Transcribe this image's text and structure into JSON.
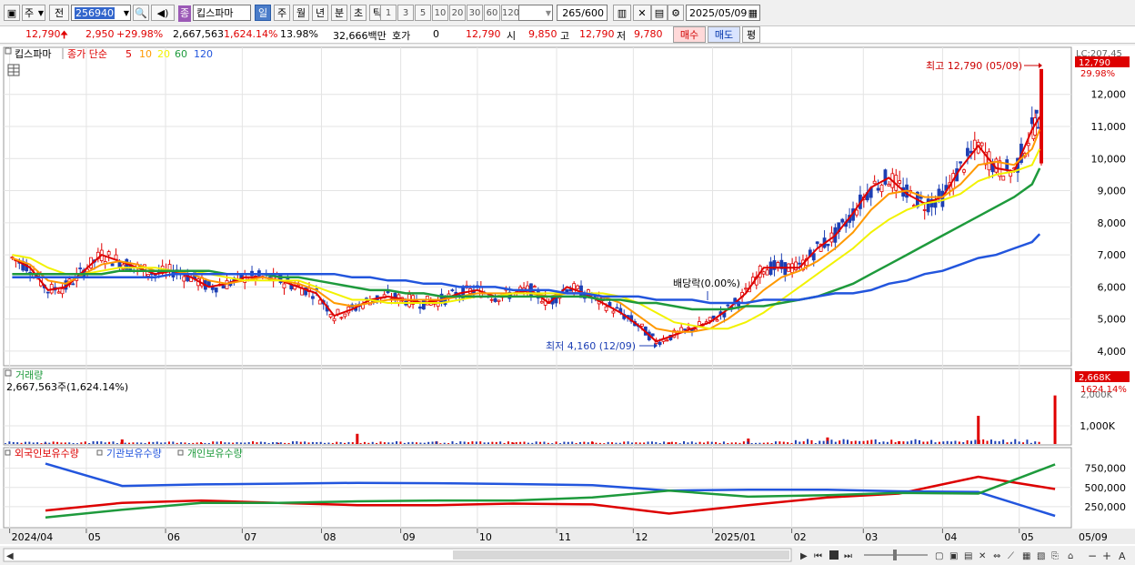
{
  "toolbar": {
    "type_select": "주",
    "cmp_select": "전",
    "code": "256940",
    "name_badge": "종",
    "name": "킵스파마",
    "periods": [
      "일",
      "주",
      "월",
      "년",
      "분",
      "초",
      "틱"
    ],
    "ticks": [
      "1",
      "3",
      "5",
      "10",
      "20",
      "30",
      "60",
      "120"
    ],
    "count": "265",
    "count_total": "/600",
    "date": "2025/05/09"
  },
  "quote": {
    "price": "12,790",
    "arrow": "🠉",
    "change": "2,950",
    "change_pct": "+29.98%",
    "volume": "2,667,563",
    "volume_pct": "1,624.14%",
    "turnover_pct": "13.98%",
    "amount": "32,666백만",
    "hoga_label": "호가",
    "hoga_val": "0",
    "price2": "12,790",
    "open_label": "시",
    "open": "9,850",
    "high_label": "고",
    "high": "12,790",
    "low_label": "저",
    "low": "9,780",
    "buy": "매수",
    "sell": "매도",
    "eval": "평"
  },
  "price_panel": {
    "name_tag": "킵스파마",
    "legend_main": "종가 단순",
    "ma_labels": [
      "5",
      "10",
      "20",
      "60",
      "120"
    ],
    "ma_colors": [
      "#dd0000",
      "#ff9900",
      "#f2f200",
      "#1e9a3c",
      "#2255dd"
    ],
    "high_annot": "최고 12,790 (05/09)",
    "low_annot": "최저 4,160 (12/09)",
    "div_annot": "배당락(0.00%)",
    "top_cut": "LC:207.45",
    "price_tag": "12,790",
    "pct_tag": "29.98%",
    "y_ticks": [
      4000,
      5000,
      6000,
      7000,
      8000,
      9000,
      10000,
      11000,
      12000
    ],
    "y_tick_labels": [
      "4,000",
      "5,000",
      "6,000",
      "7,000",
      "8,000",
      "9,000",
      "10,000",
      "11,000",
      "12,000"
    ]
  },
  "volume_panel": {
    "title": "거래량",
    "value_text": "2,667,563주(1,624.14%)",
    "tag": "2,668K",
    "tag_pct": "1624.14%",
    "tag_behind": "2,000K",
    "y_label": "1,000K"
  },
  "holding_panel": {
    "series_labels": [
      "외국인보유수량",
      "기관보유수량",
      "개인보유수량"
    ],
    "series_colors": [
      "#dd0000",
      "#2255dd",
      "#1e9a3c"
    ],
    "y_labels": [
      "250,000",
      "500,000",
      "750,000"
    ]
  },
  "x_axis": {
    "labels": [
      "2024/04",
      "05",
      "06",
      "07",
      "08",
      "09",
      "10",
      "11",
      "12",
      "2025/01",
      "02",
      "03",
      "04",
      "05"
    ],
    "right_label": "05/09"
  },
  "chart_data": [
    {
      "type": "line",
      "title": "",
      "x": [
        "2024/04/02",
        "2024/04/09",
        "2024/04/16",
        "2024/04/23",
        "2024/04/30",
        "2024/05/07",
        "2024/05/14",
        "2024/05/21",
        "2024/05/28",
        "2024/06/04",
        "2024/06/11",
        "2024/06/18",
        "2024/06/25",
        "2024/07/02",
        "2024/07/09",
        "2024/07/16",
        "2024/07/23",
        "2024/07/30",
        "2024/08/06",
        "2024/08/13",
        "2024/08/20",
        "2024/08/27",
        "2024/09/03",
        "2024/09/10",
        "2024/09/17",
        "2024/09/24",
        "2024/10/01",
        "2024/10/08",
        "2024/10/15",
        "2024/10/22",
        "2024/10/29",
        "2024/11/05",
        "2024/11/12",
        "2024/11/19",
        "2024/11/26",
        "2024/12/03",
        "2024/12/10",
        "2024/12/17",
        "2024/12/24",
        "2024/12/31",
        "2025/01/07",
        "2025/01/14",
        "2025/01/21",
        "2025/01/28",
        "2025/02/04",
        "2025/02/11",
        "2025/02/18",
        "2025/02/25",
        "2025/03/04",
        "2025/03/11",
        "2025/03/18",
        "2025/03/25",
        "2025/04/01",
        "2025/04/08",
        "2025/04/15",
        "2025/04/22",
        "2025/04/29",
        "2025/05/06",
        "2025/05/09"
      ],
      "series": [
        {
          "name": "5",
          "values": [
            6900,
            6600,
            5900,
            6000,
            6500,
            7000,
            6800,
            6600,
            6400,
            6500,
            6300,
            6000,
            6100,
            6300,
            6300,
            6200,
            6000,
            5800,
            5100,
            5300,
            5600,
            5700,
            5600,
            5500,
            5600,
            5800,
            5900,
            5700,
            5800,
            5900,
            5500,
            6000,
            5800,
            5500,
            5200,
            4800,
            4300,
            4500,
            4700,
            4900,
            5300,
            5800,
            6600,
            6600,
            6600,
            7200,
            7600,
            8300,
            9100,
            9400,
            8900,
            8600,
            8800,
            9700,
            10400,
            9700,
            9600,
            10900,
            11300
          ]
        },
        {
          "name": "10",
          "values": [
            6900,
            6700,
            6200,
            6100,
            6400,
            6700,
            6800,
            6700,
            6500,
            6500,
            6400,
            6200,
            6100,
            6200,
            6300,
            6200,
            6100,
            5900,
            5500,
            5400,
            5500,
            5600,
            5600,
            5600,
            5600,
            5700,
            5800,
            5800,
            5800,
            5800,
            5700,
            5800,
            5800,
            5700,
            5500,
            5100,
            4700,
            4600,
            4600,
            4700,
            5000,
            5400,
            5900,
            6300,
            6500,
            6800,
            7200,
            7700,
            8400,
            8900,
            9000,
            8800,
            8800,
            9200,
            9800,
            9900,
            9800,
            10300,
            10900
          ]
        },
        {
          "name": "20",
          "values": [
            7000,
            6900,
            6600,
            6400,
            6400,
            6500,
            6600,
            6600,
            6600,
            6500,
            6500,
            6400,
            6300,
            6200,
            6200,
            6200,
            6200,
            6000,
            5800,
            5600,
            5600,
            5500,
            5500,
            5500,
            5500,
            5600,
            5700,
            5700,
            5800,
            5800,
            5800,
            5800,
            5800,
            5800,
            5700,
            5500,
            5200,
            4900,
            4800,
            4700,
            4700,
            4900,
            5200,
            5600,
            6000,
            6400,
            6800,
            7200,
            7700,
            8100,
            8400,
            8600,
            8700,
            8900,
            9300,
            9500,
            9600,
            9800,
            10300
          ]
        },
        {
          "name": "60",
          "values": [
            6400,
            6400,
            6400,
            6400,
            6400,
            6400,
            6500,
            6500,
            6500,
            6500,
            6500,
            6500,
            6400,
            6400,
            6400,
            6300,
            6300,
            6200,
            6100,
            6000,
            5900,
            5900,
            5800,
            5800,
            5700,
            5700,
            5700,
            5700,
            5700,
            5700,
            5700,
            5700,
            5700,
            5600,
            5600,
            5500,
            5500,
            5400,
            5300,
            5300,
            5300,
            5400,
            5400,
            5500,
            5600,
            5700,
            5900,
            6100,
            6400,
            6700,
            7000,
            7300,
            7600,
            7900,
            8200,
            8500,
            8800,
            9200,
            9700
          ]
        },
        {
          "name": "120",
          "values": [
            6300,
            6300,
            6300,
            6300,
            6300,
            6300,
            6300,
            6300,
            6300,
            6400,
            6400,
            6400,
            6400,
            6400,
            6400,
            6400,
            6400,
            6400,
            6400,
            6300,
            6300,
            6200,
            6200,
            6100,
            6100,
            6000,
            6000,
            6000,
            5900,
            5900,
            5900,
            5800,
            5800,
            5700,
            5700,
            5700,
            5600,
            5600,
            5600,
            5500,
            5500,
            5500,
            5600,
            5600,
            5600,
            5700,
            5800,
            5800,
            5900,
            6100,
            6200,
            6400,
            6500,
            6700,
            6900,
            7000,
            7200,
            7400,
            7650
          ]
        }
      ],
      "ylim": [
        3600,
        12900
      ],
      "grid": true,
      "legend": "top-left"
    },
    {
      "type": "bar",
      "title": "거래량",
      "x": [
        "2024/04",
        "2024/05",
        "2024/06",
        "2024/07",
        "2024/08",
        "2024/09",
        "2024/10",
        "2024/11",
        "2024/12",
        "2025/01",
        "2025/02",
        "2025/03",
        "2025/04",
        "2025/05"
      ],
      "values": [
        60,
        250,
        50,
        60,
        560,
        140,
        70,
        110,
        90,
        300,
        360,
        150,
        1550,
        2668
      ],
      "ylabel": "K",
      "ylim": [
        0,
        3300
      ]
    },
    {
      "type": "line",
      "title": "",
      "x": [
        "2024/04",
        "2024/05",
        "2024/06",
        "2024/07",
        "2024/08",
        "2024/09",
        "2024/10",
        "2024/11",
        "2024/12",
        "2025/01",
        "2025/02",
        "2025/03",
        "2025/04",
        "2025/05"
      ],
      "series": [
        {
          "name": "외국인보유수량",
          "values": [
            200000,
            300000,
            330000,
            300000,
            270000,
            270000,
            290000,
            280000,
            160000,
            270000,
            370000,
            420000,
            640000,
            480000
          ]
        },
        {
          "name": "기관보유수량",
          "values": [
            810000,
            520000,
            540000,
            550000,
            560000,
            555000,
            545000,
            530000,
            460000,
            470000,
            470000,
            450000,
            440000,
            130000
          ]
        },
        {
          "name": "개인보유수량",
          "values": [
            110000,
            210000,
            300000,
            300000,
            320000,
            330000,
            330000,
            370000,
            460000,
            380000,
            400000,
            430000,
            420000,
            800000
          ]
        }
      ],
      "ylim": [
        0,
        900000
      ],
      "legend": "top-left"
    }
  ]
}
